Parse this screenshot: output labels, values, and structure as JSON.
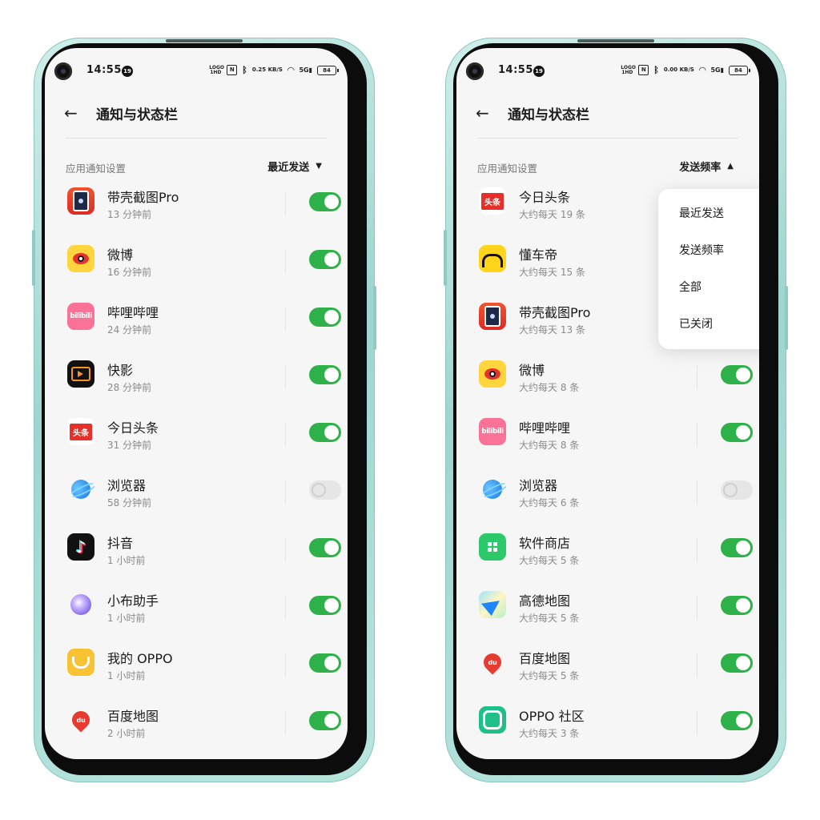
{
  "phones": [
    {
      "status": {
        "time": "14:55",
        "badge": "19",
        "speed": "0.25 KB/S",
        "battery": "84"
      },
      "header": {
        "title": "通知与状态栏"
      },
      "section": {
        "label": "应用通知设置",
        "sort_label": "最近发送",
        "sort_caret": "▼"
      },
      "apps": [
        {
          "name": "带壳截图Pro",
          "sub": "13 分钟前",
          "icon": "screenshot-app-icon",
          "on": true
        },
        {
          "name": "微博",
          "sub": "16 分钟前",
          "icon": "weibo-icon",
          "on": true
        },
        {
          "name": "哔哩哔哩",
          "sub": "24 分钟前",
          "icon": "bilibili-icon",
          "on": true
        },
        {
          "name": "快影",
          "sub": "28 分钟前",
          "icon": "kuaiying-icon",
          "on": true
        },
        {
          "name": "今日头条",
          "sub": "31 分钟前",
          "icon": "toutiao-icon",
          "on": true
        },
        {
          "name": "浏览器",
          "sub": "58 分钟前",
          "icon": "browser-icon",
          "on": false
        },
        {
          "name": "抖音",
          "sub": "1 小时前",
          "icon": "douyin-icon",
          "on": true
        },
        {
          "name": "小布助手",
          "sub": "1 小时前",
          "icon": "xiaobu-icon",
          "on": true
        },
        {
          "name": "我的 OPPO",
          "sub": "1 小时前",
          "icon": "my-oppo-icon",
          "on": true
        },
        {
          "name": "百度地图",
          "sub": "2 小时前",
          "icon": "baidu-map-icon",
          "on": true
        }
      ]
    },
    {
      "status": {
        "time": "14:55",
        "badge": "19",
        "speed": "0.00 KB/S",
        "battery": "84"
      },
      "header": {
        "title": "通知与状态栏"
      },
      "section": {
        "label": "应用通知设置",
        "sort_label": "发送频率",
        "sort_caret": "▲"
      },
      "dropdown": [
        "最近发送",
        "发送频率",
        "全部",
        "已关闭"
      ],
      "apps": [
        {
          "name": "今日头条",
          "sub": "大约每天 19 条",
          "icon": "toutiao-icon",
          "on": true
        },
        {
          "name": "懂车帝",
          "sub": "大约每天 15 条",
          "icon": "dongchedi-icon",
          "on": true
        },
        {
          "name": "带壳截图Pro",
          "sub": "大约每天 13 条",
          "icon": "screenshot-app-icon",
          "on": true
        },
        {
          "name": "微博",
          "sub": "大约每天 8 条",
          "icon": "weibo-icon",
          "on": true
        },
        {
          "name": "哔哩哔哩",
          "sub": "大约每天 8 条",
          "icon": "bilibili-icon",
          "on": true
        },
        {
          "name": "浏览器",
          "sub": "大约每天 6 条",
          "icon": "browser-icon",
          "on": false
        },
        {
          "name": "软件商店",
          "sub": "大约每天 5 条",
          "icon": "app-store-icon",
          "on": true
        },
        {
          "name": "高德地图",
          "sub": "大约每天 5 条",
          "icon": "amap-icon",
          "on": true
        },
        {
          "name": "百度地图",
          "sub": "大约每天 5 条",
          "icon": "baidu-map-icon",
          "on": true
        },
        {
          "name": "OPPO 社区",
          "sub": "大约每天 3 条",
          "icon": "oppo-community-icon",
          "on": true
        }
      ]
    }
  ],
  "icon_text": {
    "bilibili": "bilibili",
    "toutiao": "头条",
    "douyin": "♪",
    "baidu": "du"
  }
}
